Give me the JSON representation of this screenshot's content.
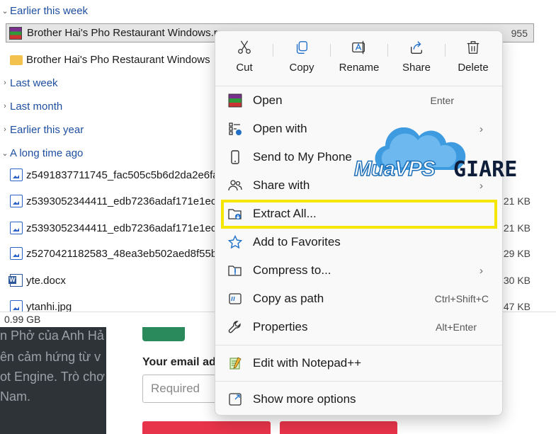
{
  "explorer": {
    "groups": {
      "earlier_this_week": "Earlier this week",
      "last_week": "Last week",
      "last_month": "Last month",
      "earlier_this_year": "Earlier this year",
      "a_long_time_ago": "A long time ago"
    },
    "files": [
      {
        "name": "Brother Hai's Pho Restaurant Windows.ra",
        "size": "955",
        "icon": "winrar-archive-icon",
        "selected": true
      },
      {
        "name": "Brother Hai's Pho Restaurant Windows",
        "size": "",
        "icon": "folder-icon"
      },
      {
        "name": "z5491837711745_fac505c5b6d2da2e6fa",
        "size": "",
        "icon": "image-file-icon"
      },
      {
        "name": "z5393052344411_edb7236adaf171e1ecc",
        "size": "21 KB",
        "icon": "image-file-icon"
      },
      {
        "name": "z5393052344411_edb7236adaf171e1ecc",
        "size": "21 KB",
        "icon": "image-file-icon"
      },
      {
        "name": "z5270421182583_48ea3eb502aed8f55be",
        "size": "29 KB",
        "icon": "image-file-icon"
      },
      {
        "name": "yte.docx",
        "size": "30 KB",
        "icon": "word-document-icon"
      },
      {
        "name": "ytanhi.jpg",
        "size": "47 KB",
        "icon": "image-file-icon"
      }
    ],
    "status_size": "0.99 GB"
  },
  "webpage": {
    "left_lines": [
      "n Phở của Anh Hả",
      "ên cảm hứng từ v",
      "ot Engine. Trò chơ",
      "Nam."
    ],
    "email_label": "Your email add",
    "email_placeholder": "Required"
  },
  "context_menu": {
    "quick_actions": [
      {
        "label": "Cut",
        "icon": "scissors-icon"
      },
      {
        "label": "Copy",
        "icon": "copy-icon"
      },
      {
        "label": "Rename",
        "icon": "rename-icon"
      },
      {
        "label": "Share",
        "icon": "share-icon"
      },
      {
        "label": "Delete",
        "icon": "trash-icon"
      }
    ],
    "items": [
      {
        "label": "Open",
        "shortcut": "Enter",
        "icon": "winrar-icon"
      },
      {
        "label": "Open with",
        "submenu": true,
        "icon": "open-with-icon"
      },
      {
        "label": "Send to My Phone",
        "icon": "phone-icon"
      },
      {
        "label": "Share with",
        "submenu": true,
        "icon": "share-with-icon"
      },
      {
        "label": "Extract All...",
        "icon": "extract-folder-icon",
        "highlighted": true
      },
      {
        "label": "Add to Favorites",
        "icon": "star-icon"
      },
      {
        "label": "Compress to...",
        "submenu": true,
        "icon": "compress-icon"
      },
      {
        "label": "Copy as path",
        "shortcut": "Ctrl+Shift+C",
        "icon": "copy-path-icon"
      },
      {
        "label": "Properties",
        "shortcut": "Alt+Enter",
        "icon": "wrench-icon"
      },
      {
        "label": "Edit with Notepad++",
        "icon": "notepad-plus-plus-icon"
      },
      {
        "label": "Show more options",
        "icon": "show-more-icon"
      }
    ],
    "submenu_arrow": "›",
    "highlight_color": "#f5e600"
  },
  "watermark": {
    "part1": "MuaVPS",
    "part2": "GIARE"
  }
}
